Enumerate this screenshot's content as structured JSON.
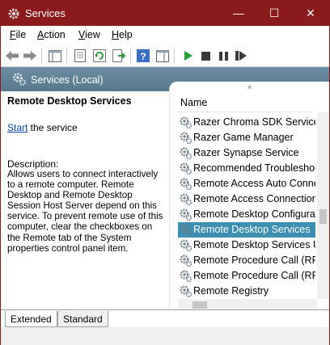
{
  "window": {
    "title": "Services",
    "controls": {
      "minimize": "—",
      "maximize": "☐",
      "close": "✕"
    }
  },
  "menu": [
    {
      "accel": "F",
      "rest": "ile"
    },
    {
      "accel": "A",
      "rest": "ction"
    },
    {
      "accel": "V",
      "rest": "iew"
    },
    {
      "accel": "H",
      "rest": "elp"
    }
  ],
  "toolbar_icons": [
    "back-arrow-icon",
    "forward-arrow-icon",
    "console-tree-icon",
    "properties-icon",
    "refresh-icon",
    "export-list-icon",
    "help-icon",
    "show-hide-pane-icon",
    "start-service-icon",
    "stop-service-icon",
    "pause-service-icon",
    "restart-service-icon"
  ],
  "scope": {
    "label": "Services (Local)"
  },
  "detail": {
    "service_name": "Remote Desktop Services",
    "start_link": "Start",
    "start_suffix": " the service",
    "description_label": "Description:",
    "description": "Allows users to connect interactively to a remote computer. Remote Desktop and Remote Desktop Session Host Server depend on this service. To prevent remote use of this computer, clear the checkboxes on the Remote tab of the System properties control panel item."
  },
  "list": {
    "sort_indicator": "˄",
    "column_name": "Name",
    "rows": [
      {
        "name": "Razer Chroma SDK Service",
        "selected": false
      },
      {
        "name": "Razer Game Manager",
        "selected": false
      },
      {
        "name": "Razer Synapse Service",
        "selected": false
      },
      {
        "name": "Recommended Troubleshooti",
        "selected": false
      },
      {
        "name": "Remote Access Auto Connect",
        "selected": false
      },
      {
        "name": "Remote Access Connection Ma",
        "selected": false
      },
      {
        "name": "Remote Desktop Configuratio",
        "selected": false
      },
      {
        "name": "Remote Desktop Services",
        "selected": true
      },
      {
        "name": "Remote Desktop Services Us...",
        "selected": false
      },
      {
        "name": "Remote Procedure Call (RPC)",
        "selected": false
      },
      {
        "name": "Remote Procedure Call (RPC)",
        "selected": false
      },
      {
        "name": "Remote Registry",
        "selected": false
      }
    ]
  },
  "tabs": [
    {
      "label": "Extended",
      "active": true
    },
    {
      "label": "Standard",
      "active": false
    }
  ],
  "colors": {
    "titlebar": "#8b1a1a",
    "scope_header": "#5f8196",
    "selection": "#3c8fb0",
    "link": "#0645ad"
  }
}
